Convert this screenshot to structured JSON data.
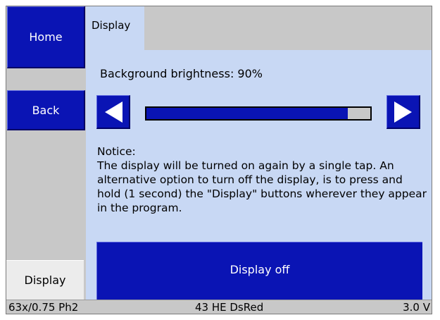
{
  "sidebar": {
    "home_label": "Home",
    "back_label": "Back",
    "display_label": "Display"
  },
  "tabs": [
    {
      "label": "Display",
      "active": true
    }
  ],
  "brightness": {
    "label": "Background brightness: 90%",
    "value_percent": 90
  },
  "notice": {
    "title": "Notice:",
    "body": "The display will be turned on again by a single tap. An alternative option to turn off the display, is to press and hold (1 second) the \"Display\" buttons wherever they appear in the program."
  },
  "display_off_label": "Display off",
  "status": {
    "left": "63x/0.75 Ph2",
    "middle": "43 HE DsRed",
    "right": "3.0 V"
  },
  "colors": {
    "accent": "#0a14b4",
    "panel": "#c8d8f4",
    "chrome": "#c8c8c8"
  },
  "icons": {
    "left": "triangle-left-icon",
    "right": "triangle-right-icon"
  }
}
